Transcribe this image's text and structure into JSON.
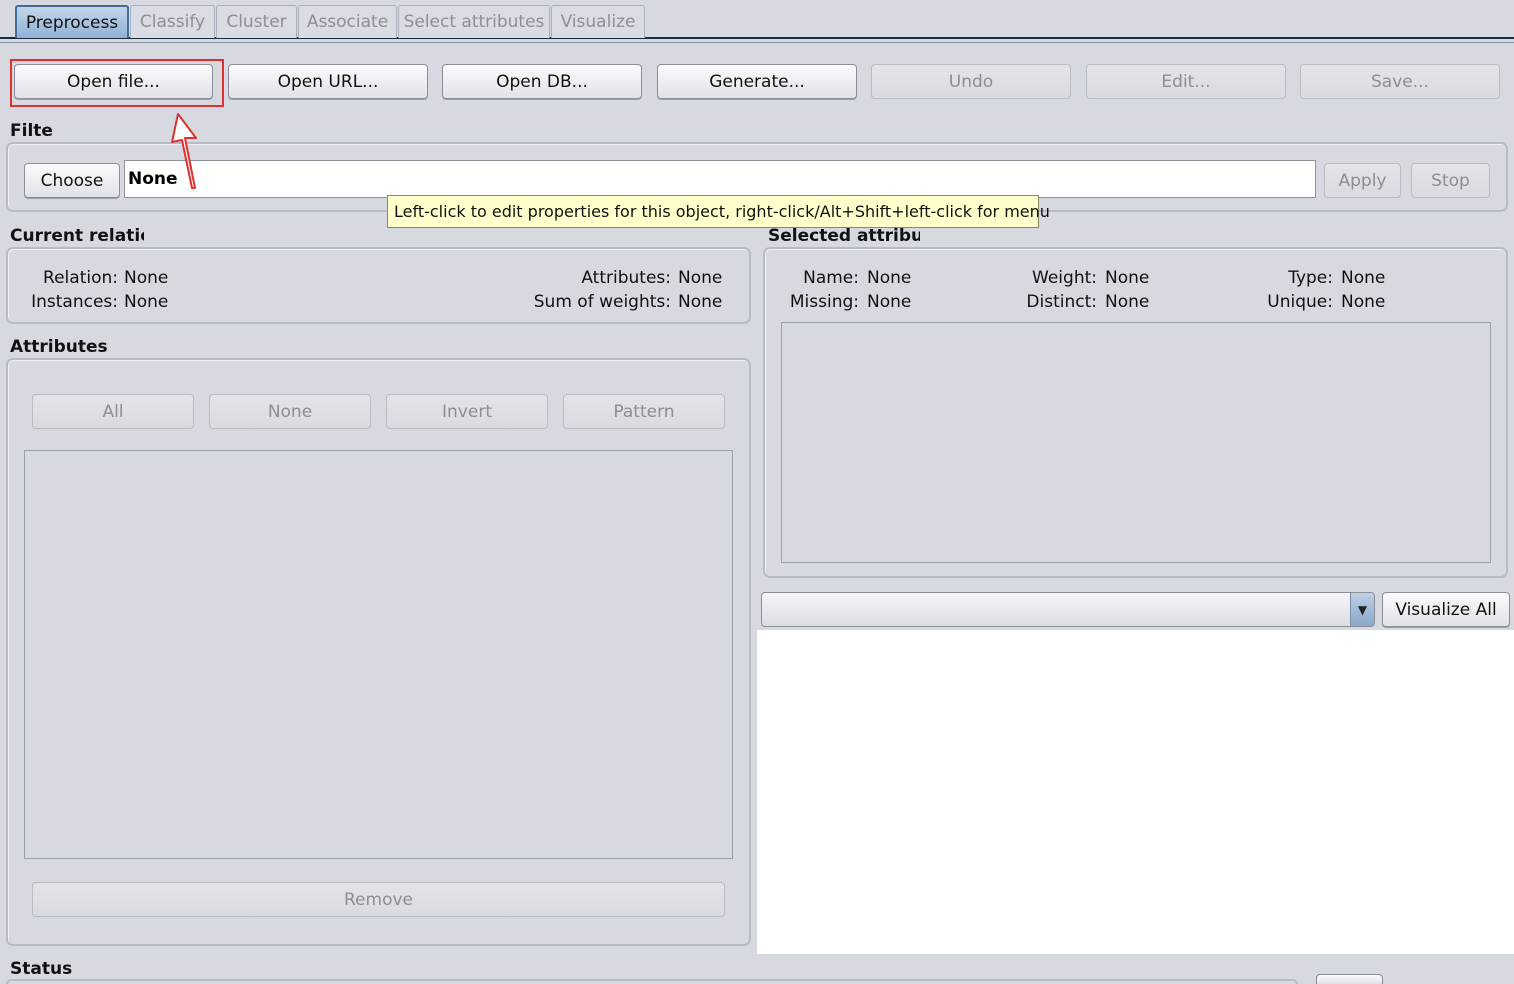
{
  "tabs": [
    {
      "label": "Preprocess",
      "active": true
    },
    {
      "label": "Classify",
      "active": false
    },
    {
      "label": "Cluster",
      "active": false
    },
    {
      "label": "Associate",
      "active": false
    },
    {
      "label": "Select attributes",
      "active": false
    },
    {
      "label": "Visualize",
      "active": false
    }
  ],
  "toolbar": {
    "open_file": "Open file...",
    "open_url": "Open URL...",
    "open_db": "Open DB...",
    "generate": "Generate...",
    "undo": "Undo",
    "edit": "Edit...",
    "save": "Save..."
  },
  "filter": {
    "title": "Filter",
    "choose": "Choose",
    "value": "None",
    "apply": "Apply",
    "stop": "Stop",
    "tooltip": "Left-click to edit properties for this object, right-click/Alt+Shift+left-click for menu"
  },
  "current_relation": {
    "title": "Current relation",
    "relation_label": "Relation:",
    "relation_value": "None",
    "instances_label": "Instances:",
    "instances_value": "None",
    "attributes_label": "Attributes:",
    "attributes_value": "None",
    "sum_weights_label": "Sum of weights:",
    "sum_weights_value": "None"
  },
  "selected_attribute": {
    "title": "Selected attribute",
    "name_label": "Name:",
    "name_value": "None",
    "missing_label": "Missing:",
    "missing_value": "None",
    "weight_label": "Weight:",
    "weight_value": "None",
    "distinct_label": "Distinct:",
    "distinct_value": "None",
    "type_label": "Type:",
    "type_value": "None",
    "unique_label": "Unique:",
    "unique_value": "None",
    "visualize_all": "Visualize All"
  },
  "attributes": {
    "title": "Attributes",
    "all": "All",
    "none": "None",
    "invert": "Invert",
    "pattern": "Pattern",
    "remove": "Remove"
  },
  "status": {
    "title": "Status"
  },
  "colors": {
    "highlight": "#e03030",
    "tooltip_bg": "#ffffcc",
    "active_tab": "#8fb1d6"
  }
}
